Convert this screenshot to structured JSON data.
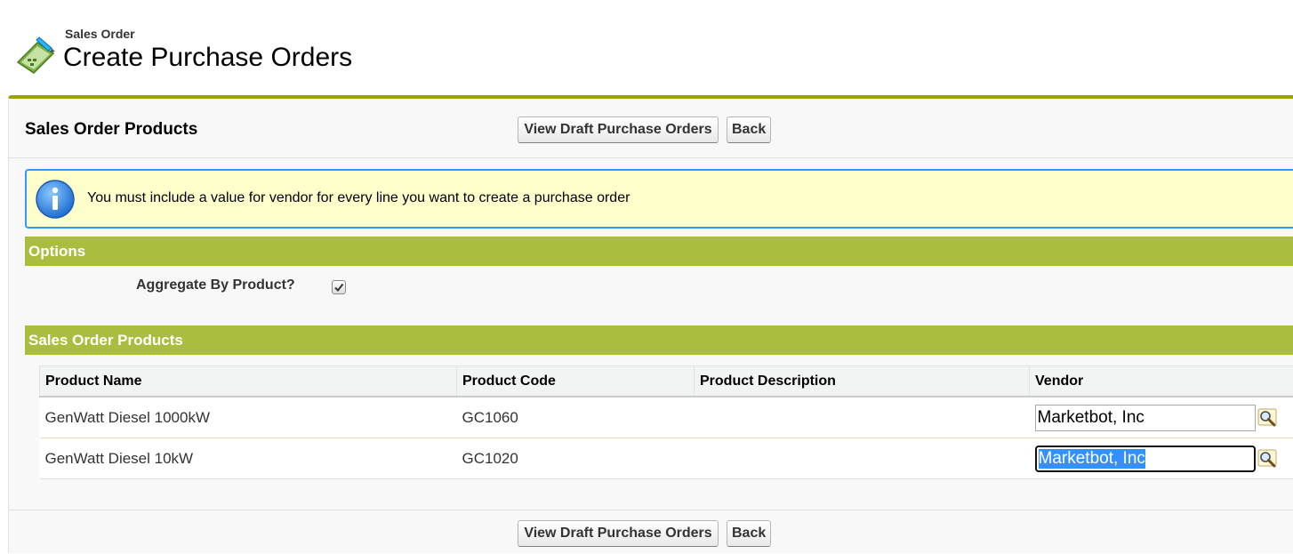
{
  "header": {
    "breadcrumb": "Sales Order",
    "title": "Create Purchase Orders",
    "icon": "sales-order-icon"
  },
  "block": {
    "title": "Sales Order Products",
    "buttons": {
      "view_draft": "View Draft Purchase Orders",
      "back": "Back"
    }
  },
  "info": {
    "icon": "info-icon",
    "message": "You must include a value for vendor for every line you want to create a purchase order"
  },
  "options": {
    "section_title": "Options",
    "aggregate_label": "Aggregate By Product?",
    "aggregate_checked": true
  },
  "products": {
    "section_title": "Sales Order Products",
    "columns": [
      "Product Name",
      "Product Code",
      "Product Description",
      "Vendor"
    ],
    "rows": [
      {
        "name": "GenWatt Diesel 1000kW",
        "code": "GC1060",
        "description": "",
        "vendor": "Marketbot, Inc"
      },
      {
        "name": "GenWatt Diesel 10kW",
        "code": "GC1020",
        "description": "",
        "vendor": "Marketbot, Inc"
      }
    ]
  },
  "colors": {
    "accent": "#99a000",
    "section_bar": "#aabd3e",
    "info_border": "#3399ff",
    "info_background": "#ffffcc"
  }
}
